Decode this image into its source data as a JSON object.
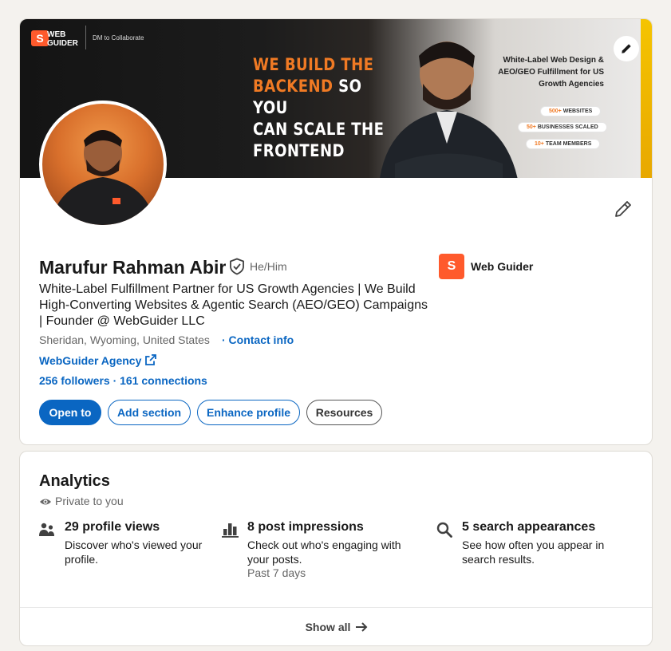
{
  "banner": {
    "brand_name": "WEB GUIDER",
    "brand_cta": "DM to Collaborate",
    "headline_highlight_1": "WE BUILD THE",
    "headline_highlight_2": "BACKEND",
    "headline_rest_1": " SO YOU",
    "headline_rest_2": "CAN SCALE THE",
    "headline_rest_3": "FRONTEND",
    "tagline": "White-Label Web Design & AEO/GEO Fulfillment for US Growth Agencies",
    "stats": [
      {
        "num": "500+",
        "label": " WEBSITES"
      },
      {
        "num": "50+",
        "label": " BUSINESSES SCALED"
      },
      {
        "num": "10+",
        "label": " TEAM MEMBERS"
      }
    ]
  },
  "profile": {
    "name": "Marufur Rahman Abir",
    "pronouns": "He/Him",
    "headline": "White-Label Fulfillment Partner for US Growth Agencies | We Build High-Converting Websites & Agentic Search (AEO/GEO) Campaigns | Founder @ WebGuider LLC",
    "location": "Sheridan, Wyoming, United States",
    "contact_label": "· Contact info",
    "website_label": "WebGuider Agency",
    "followers_connections": "256 followers · 161 connections",
    "company_name": "Web Guider",
    "buttons": {
      "open_to": "Open to",
      "add_section": "Add section",
      "enhance_profile": "Enhance profile",
      "resources": "Resources"
    }
  },
  "analytics": {
    "title": "Analytics",
    "privacy": "Private to you",
    "metrics": [
      {
        "title": "29 profile views",
        "desc": "Discover who's viewed your profile.",
        "sub": ""
      },
      {
        "title": "8 post impressions",
        "desc": "Check out who's engaging with your posts.",
        "sub": "Past 7 days"
      },
      {
        "title": "5 search appearances",
        "desc": "See how often you appear in search results.",
        "sub": ""
      }
    ],
    "show_all": "Show all"
  },
  "colors": {
    "brand_blue": "#0a66c2",
    "brand_orange": "#ff5a2c",
    "banner_accent": "#f07a24"
  }
}
